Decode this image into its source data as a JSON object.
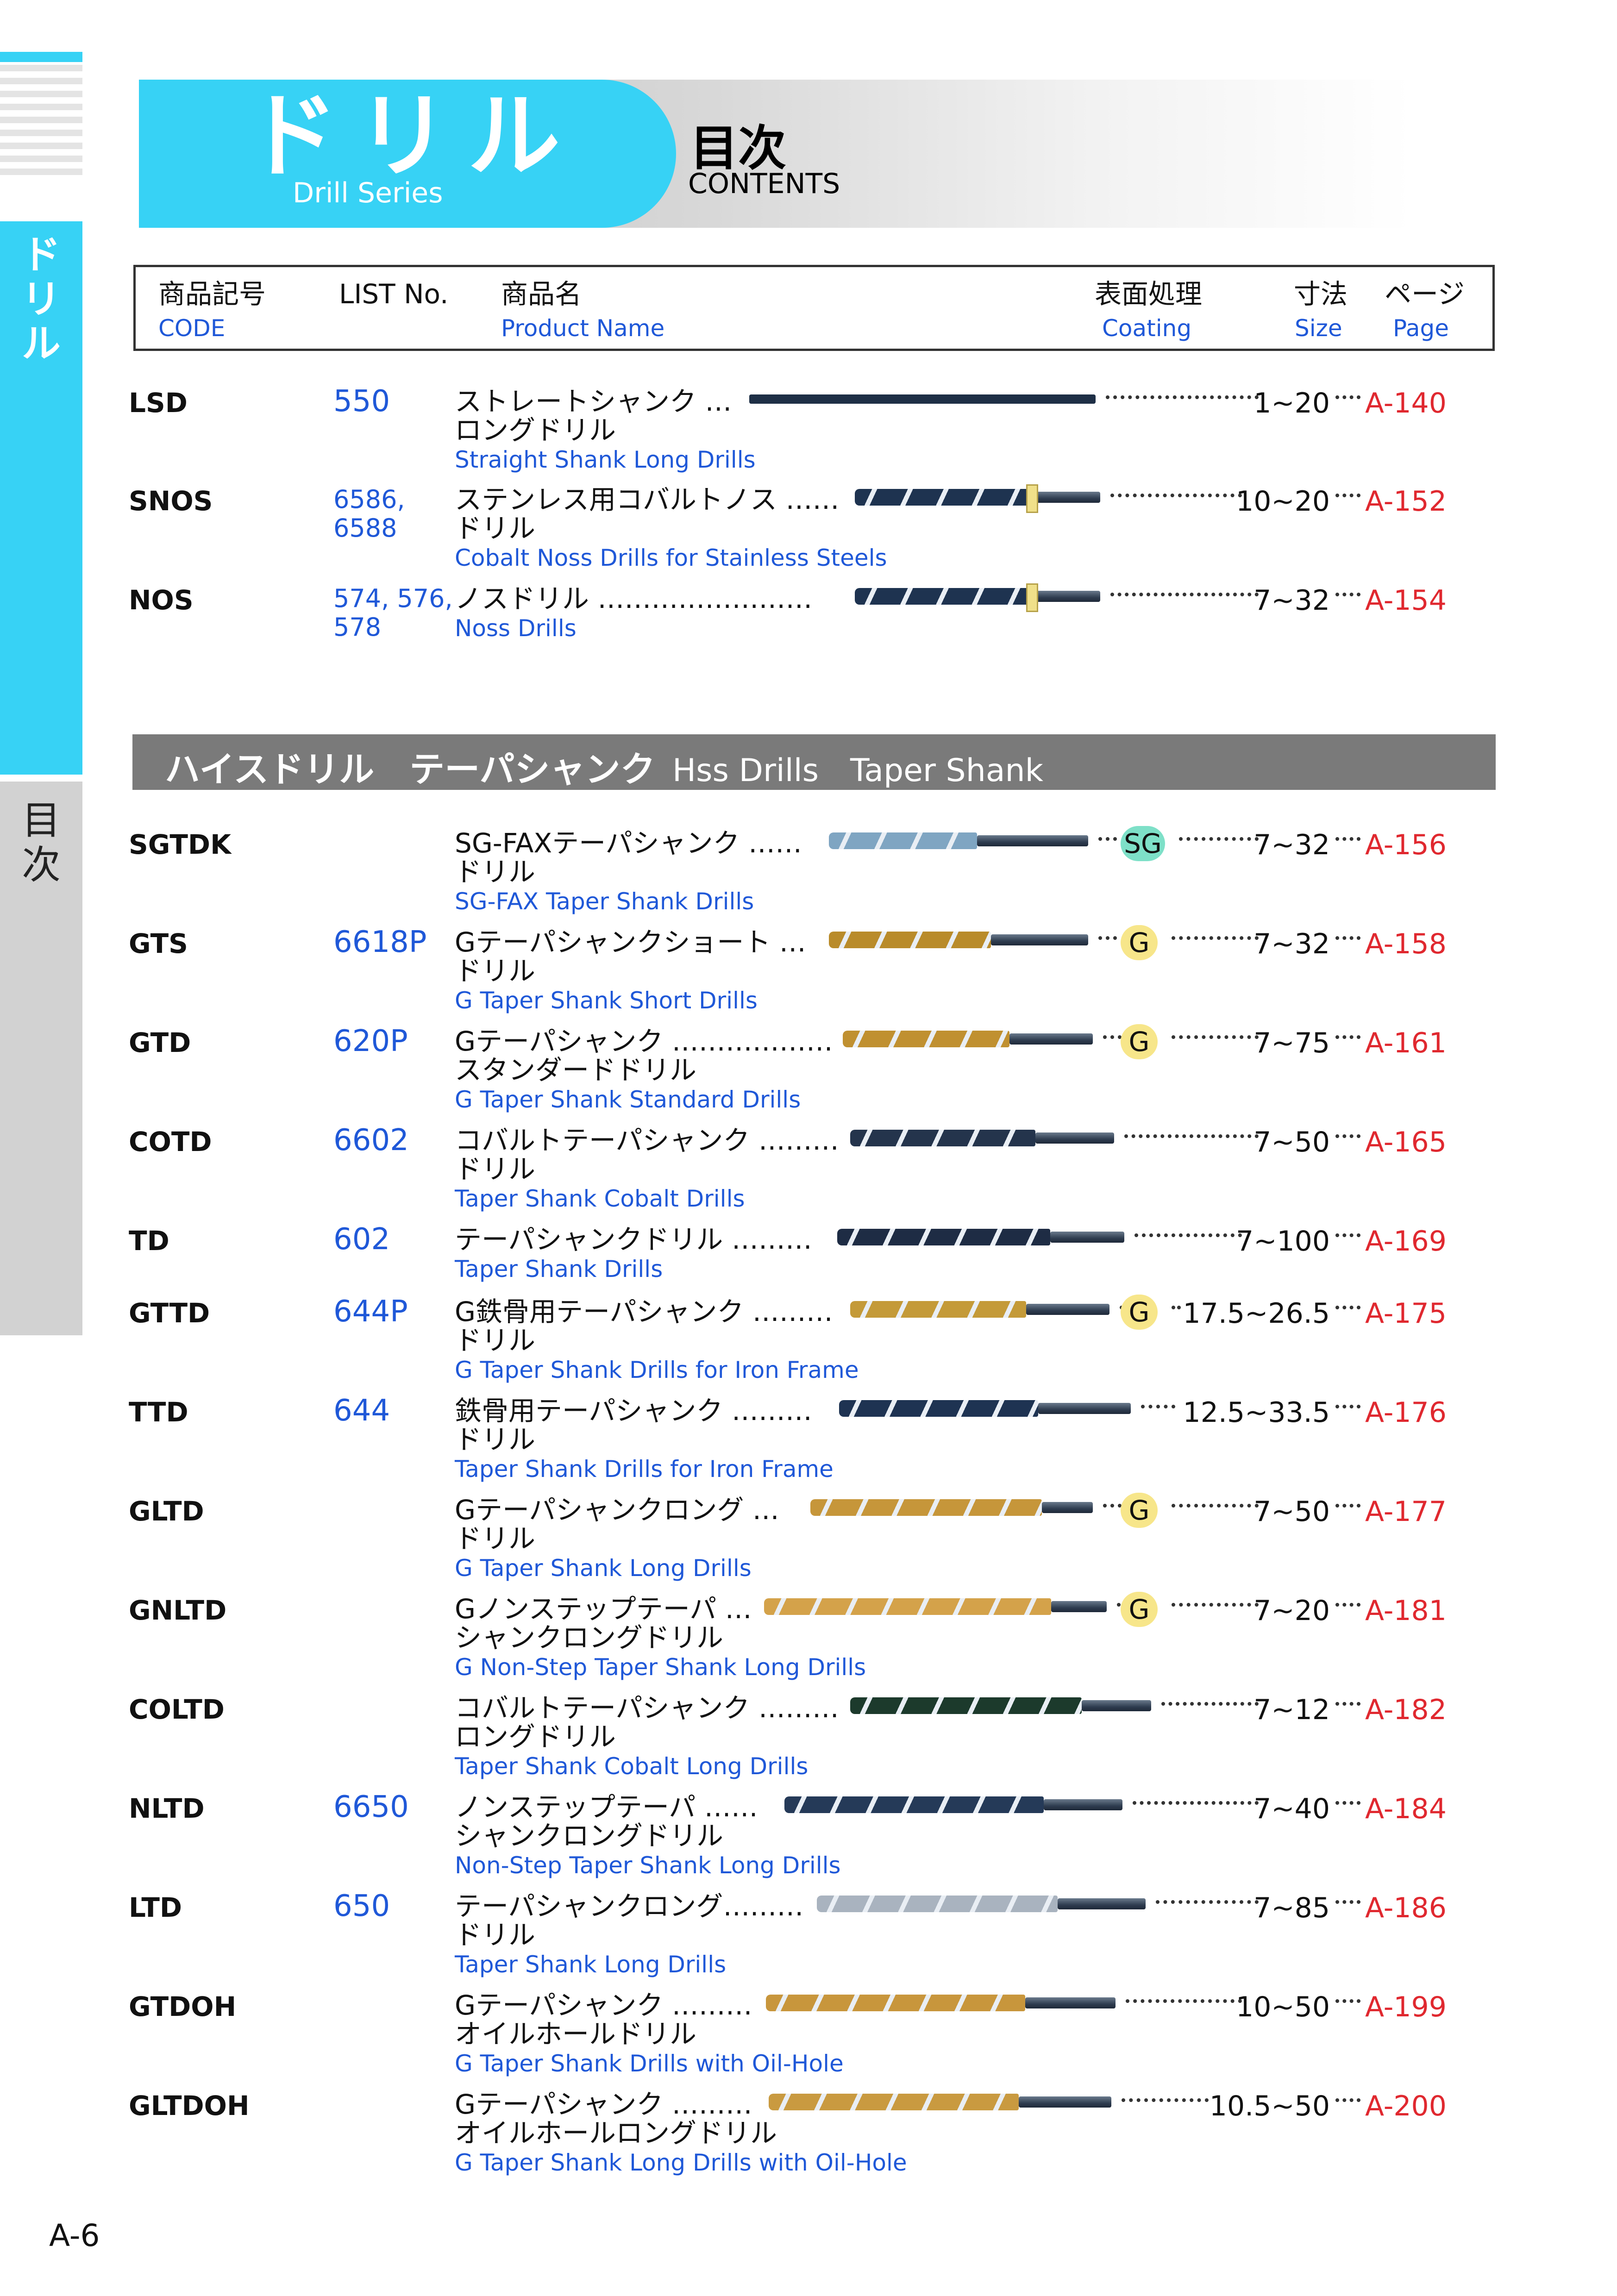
{
  "sidebar": {
    "top_tab": "ドリル",
    "bottom_tab": "目次"
  },
  "header": {
    "title": "ドリル",
    "subtitle": "Drill Series",
    "toc_jp": "目次",
    "toc_en": "CONTENTS"
  },
  "columns": {
    "code_jp": "商品記号",
    "code_en": "CODE",
    "list_no": "LIST No.",
    "name_jp": "商品名",
    "name_en": "Product Name",
    "coating_jp": "表面処理",
    "coating_en": "Coating",
    "size_jp": "寸法",
    "size_en": "Size",
    "page_jp": "ページ",
    "page_en": "Page"
  },
  "section1": [
    {
      "code": "LSD",
      "list_no": "550",
      "jp": "ストレートシャンク …\nロングドリル",
      "en": "Straight Shank Long Drills",
      "size": "1~20",
      "page": "A-140",
      "coating": "",
      "color": "#1e2f46"
    },
    {
      "code": "SNOS",
      "list_no": "6586,\n6588",
      "jp": "ステンレス用コバルトノス ……\nドリル",
      "en": "Cobalt Noss Drills for Stainless Steels",
      "size": "10~20",
      "page": "A-152",
      "coating": "",
      "color": "#1e3350"
    },
    {
      "code": "NOS",
      "list_no": "574, 576,\n578",
      "jp": "ノスドリル ……………………",
      "en": "Noss Drills",
      "size": "7~32",
      "page": "A-154",
      "coating": "",
      "color": "#1e3350"
    }
  ],
  "section2_title": {
    "jp": "ハイスドリル　テーパシャンク",
    "en": "Hss Drills　Taper Shank"
  },
  "section2": [
    {
      "code": "SGTDK",
      "list_no": "",
      "jp": "SG-FAXテーパシャンク ……\nドリル",
      "en": "SG-FAX Taper Shank Drills",
      "coating": "SG",
      "size": "7~32",
      "page": "A-156",
      "color": "#7fa5c2"
    },
    {
      "code": "GTS",
      "list_no": "6618P",
      "jp": "Gテーパシャンクショート …\nドリル",
      "en": "G Taper Shank Short Drills",
      "coating": "G",
      "size": "7~32",
      "page": "A-158",
      "color": "#b98b2a"
    },
    {
      "code": "GTD",
      "list_no": "620P",
      "jp": "Gテーパシャンク ………………\nスタンダードドリル",
      "en": "G Taper Shank Standard Drills",
      "coating": "G",
      "size": "7~75",
      "page": "A-161",
      "color": "#c09030"
    },
    {
      "code": "COTD",
      "list_no": "6602",
      "jp": "コバルトテーパシャンク ………\nドリル",
      "en": "Taper Shank Cobalt Drills",
      "coating": "",
      "size": "7~50",
      "page": "A-165",
      "color": "#24344c"
    },
    {
      "code": "TD",
      "list_no": "602",
      "jp": "テーパシャンクドリル ………",
      "en": "Taper Shank Drills",
      "coating": "",
      "size": "7~100",
      "page": "A-169",
      "color": "#1e2c44"
    },
    {
      "code": "GTTD",
      "list_no": "644P",
      "jp": "G鉄骨用テーパシャンク ………\nドリル",
      "en": "G Taper Shank Drills for Iron Frame",
      "coating": "G",
      "size": "17.5~26.5",
      "page": "A-175",
      "color": "#c49a38"
    },
    {
      "code": "TTD",
      "list_no": "644",
      "jp": "鉄骨用テーパシャンク ………\nドリル",
      "en": "Taper Shank Drills for Iron Frame",
      "coating": "",
      "size": "12.5~33.5",
      "page": "A-176",
      "color": "#1e3352"
    },
    {
      "code": "GLTD",
      "list_no": "",
      "jp": "Gテーパシャンクロング …\nドリル",
      "en": "G Taper Shank Long Drills",
      "coating": "G",
      "size": "7~50",
      "page": "A-177",
      "color": "#c6963a"
    },
    {
      "code": "GNLTD",
      "list_no": "",
      "jp": "Gノンステップテーパ …\nシャンクロングドリル",
      "en": "G Non-Step Taper Shank Long Drills",
      "coating": "G",
      "size": "7~20",
      "page": "A-181",
      "color": "#d4a24a"
    },
    {
      "code": "COLTD",
      "list_no": "",
      "jp": "コバルトテーパシャンク ………\nロングドリル",
      "en": "Taper Shank Cobalt Long Drills",
      "coating": "",
      "size": "7~12",
      "page": "A-182",
      "color": "#1c3a2c"
    },
    {
      "code": "NLTD",
      "list_no": "6650",
      "jp": "ノンステップテーパ ……\nシャンクロングドリル",
      "en": "Non-Step Taper Shank Long Drills",
      "coating": "",
      "size": "7~40",
      "page": "A-184",
      "color": "#253a58"
    },
    {
      "code": "LTD",
      "list_no": "650",
      "jp": "テーパシャンクロング………\nドリル",
      "en": "Taper Shank Long Drills",
      "coating": "",
      "size": "7~85",
      "page": "A-186",
      "color": "#a9b3bf"
    },
    {
      "code": "GTDOH",
      "list_no": "",
      "jp": "Gテーパシャンク ………\nオイルホールドリル",
      "en": "G Taper Shank Drills with Oil-Hole",
      "coating": "",
      "size": "10~50",
      "page": "A-199",
      "color": "#c8963c"
    },
    {
      "code": "GLTDOH",
      "list_no": "",
      "jp": "Gテーパシャンク ………\nオイルホールロングドリル",
      "en": "G Taper Shank Long Drills with Oil-Hole",
      "coating": "",
      "size": "10.5~50",
      "page": "A-200",
      "color": "#c99a40"
    }
  ],
  "page_number": "A-6",
  "colors": {
    "accent": "#37d2f5",
    "link_blue": "#1f58d8",
    "page_red": "#e0282f",
    "sg_badge": "#7ee0c8",
    "g_badge": "#f7e68a"
  }
}
